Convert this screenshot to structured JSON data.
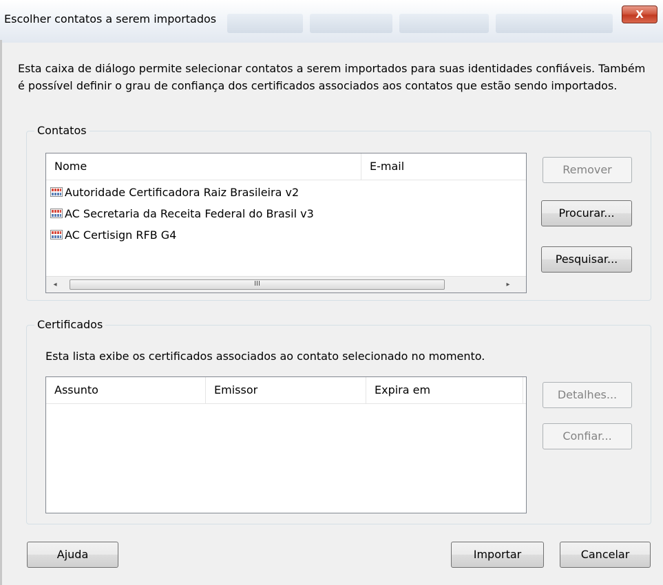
{
  "window": {
    "title": "Escolher contatos a serem importados",
    "close_label": "X"
  },
  "intro_text": "Esta caixa de diálogo permite selecionar contatos a serem importados para suas identidades confiáveis. Também é possível definir o grau de confiança dos certificados associados aos contatos que estão sendo importados.",
  "contacts": {
    "group_title": "Contatos",
    "columns": [
      "Nome",
      "E-mail"
    ],
    "rows": [
      {
        "name": "Autoridade Certificadora Raiz Brasileira v2",
        "email": ""
      },
      {
        "name": "AC Secretaria da Receita Federal do Brasil v3",
        "email": ""
      },
      {
        "name": "AC Certisign RFB G4",
        "email": ""
      }
    ],
    "scroll_thumb_grip": "III",
    "scroll_left_arrow": "◂",
    "scroll_right_arrow": "▸",
    "buttons": {
      "remove": "Remover",
      "browse": "Procurar...",
      "search": "Pesquisar..."
    }
  },
  "certificates": {
    "group_title": "Certificados",
    "description": "Esta lista exibe os certificados associados ao contato selecionado no momento.",
    "columns": [
      "Assunto",
      "Emissor",
      "Expira em"
    ],
    "buttons": {
      "details": "Detalhes...",
      "trust": "Confiar..."
    }
  },
  "footer": {
    "help": "Ajuda",
    "import": "Importar",
    "cancel": "Cancelar"
  },
  "icons": {
    "contact_icon": "certificate-icon",
    "close_icon": "close-icon"
  },
  "colors": {
    "dialog_bg": "#f0f0f0",
    "close_button": "#c23a22",
    "disabled_text": "#838383",
    "group_border": "#d5dfe5"
  }
}
